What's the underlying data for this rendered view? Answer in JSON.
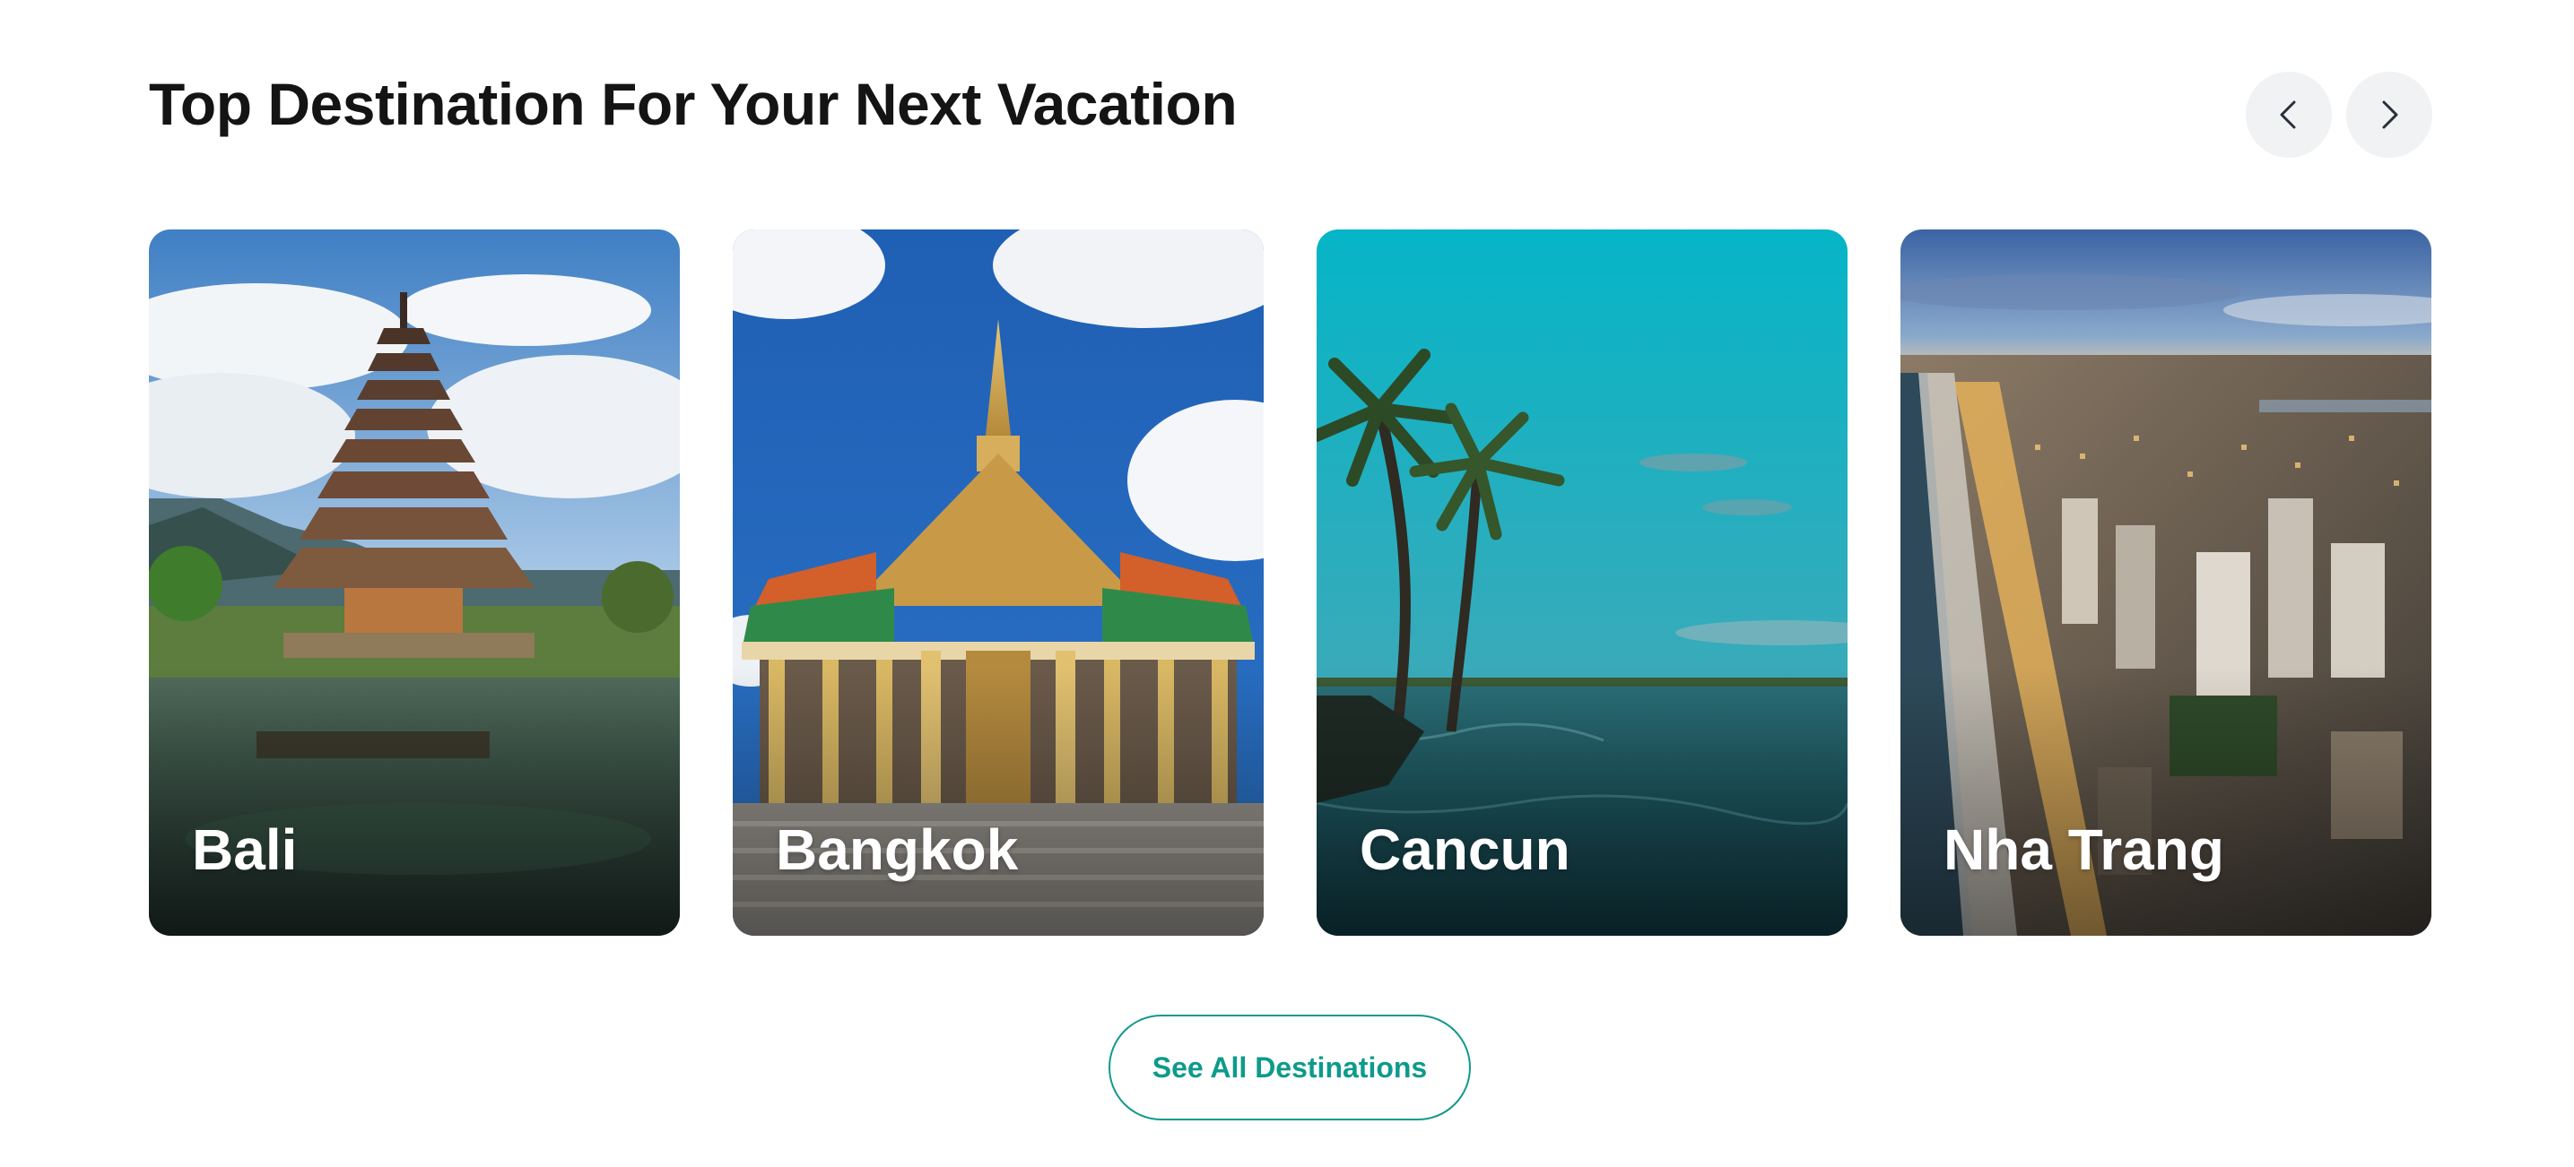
{
  "section": {
    "title": "Top Destination For Your Next Vacation"
  },
  "carousel": {
    "prev_icon": "chevron-left-icon",
    "next_icon": "chevron-right-icon"
  },
  "destinations": [
    {
      "name": "Bali"
    },
    {
      "name": "Bangkok"
    },
    {
      "name": "Cancun"
    },
    {
      "name": "Nha Trang"
    }
  ],
  "see_all_label": "See All Destinations",
  "colors": {
    "accent": "#0e9a8c",
    "title": "#141414",
    "nav_button_bg": "#f0f2f4"
  }
}
